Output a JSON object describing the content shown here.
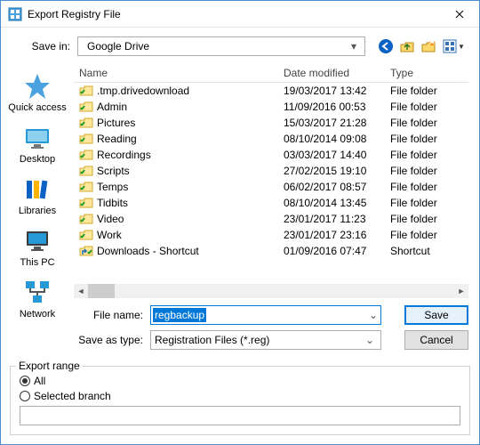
{
  "title": "Export Registry File",
  "saveInLabel": "Save in:",
  "saveInValue": "Google Drive",
  "columns": {
    "name": "Name",
    "date": "Date modified",
    "type": "Type"
  },
  "places": [
    {
      "key": "quick",
      "label": "Quick access"
    },
    {
      "key": "desktop",
      "label": "Desktop"
    },
    {
      "key": "libraries",
      "label": "Libraries"
    },
    {
      "key": "thispc",
      "label": "This PC"
    },
    {
      "key": "network",
      "label": "Network"
    }
  ],
  "files": [
    {
      "icon": "folder-check",
      "name": ".tmp.drivedownload",
      "date": "19/03/2017 13:42",
      "type": "File folder"
    },
    {
      "icon": "folder-check",
      "name": "Admin",
      "date": "11/09/2016 00:53",
      "type": "File folder"
    },
    {
      "icon": "folder-check",
      "name": "Pictures",
      "date": "15/03/2017 21:28",
      "type": "File folder"
    },
    {
      "icon": "folder-check",
      "name": "Reading",
      "date": "08/10/2014 09:08",
      "type": "File folder"
    },
    {
      "icon": "folder-check",
      "name": "Recordings",
      "date": "03/03/2017 14:40",
      "type": "File folder"
    },
    {
      "icon": "folder-check",
      "name": "Scripts",
      "date": "27/02/2015 19:10",
      "type": "File folder"
    },
    {
      "icon": "folder-check",
      "name": "Temps",
      "date": "06/02/2017 08:57",
      "type": "File folder"
    },
    {
      "icon": "folder-check",
      "name": "Tidbits",
      "date": "08/10/2014 13:45",
      "type": "File folder"
    },
    {
      "icon": "folder-check",
      "name": "Video",
      "date": "23/01/2017 11:23",
      "type": "File folder"
    },
    {
      "icon": "folder-check",
      "name": "Work",
      "date": "23/01/2017 23:16",
      "type": "File folder"
    },
    {
      "icon": "shortcut",
      "name": "Downloads - Shortcut",
      "date": "01/09/2016 07:47",
      "type": "Shortcut"
    }
  ],
  "fileNameLabel": "File name:",
  "fileNameValue": "regbackup",
  "saveAsTypeLabel": "Save as type:",
  "saveAsTypeValue": "Registration Files (*.reg)",
  "buttons": {
    "save": "Save",
    "cancel": "Cancel"
  },
  "export": {
    "legend": "Export range",
    "all": "All",
    "selected": "Selected branch",
    "choice": "all"
  },
  "icons": {
    "back": "back-arrow-icon",
    "up": "up-folder-icon",
    "newfolder": "new-folder-icon",
    "views": "views-menu-icon"
  }
}
